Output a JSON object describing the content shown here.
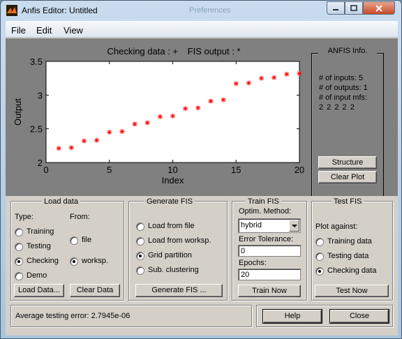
{
  "window": {
    "title": "Anfis Editor: Untitled",
    "ghost_title": "Preferences",
    "colors": {
      "plot_marker": "#ff0000"
    }
  },
  "menu": {
    "items": [
      "File",
      "Edit",
      "View"
    ]
  },
  "plot": {
    "title_left": "Checking data : +",
    "title_right": "FIS output : *"
  },
  "chart_data": {
    "type": "scatter",
    "xlabel": "Index",
    "ylabel": "Output",
    "xlim": [
      0,
      20
    ],
    "ylim": [
      2,
      3.5
    ],
    "xticks": [
      "0",
      "5",
      "10",
      "15",
      "20"
    ],
    "yticks": [
      "2",
      "2.5",
      "3",
      "3.5"
    ],
    "x": [
      1,
      2,
      3,
      4,
      5,
      6,
      7,
      8,
      9,
      10,
      11,
      12,
      13,
      14,
      15,
      16,
      17,
      18,
      19,
      20
    ],
    "y": [
      2.21,
      2.22,
      2.32,
      2.33,
      2.45,
      2.46,
      2.57,
      2.59,
      2.68,
      2.69,
      2.8,
      2.81,
      2.91,
      2.93,
      3.17,
      3.18,
      3.25,
      3.26,
      3.31,
      3.32
    ],
    "marker": "*",
    "color": "#ff0000"
  },
  "info": {
    "title": "ANFIS Info.",
    "lines": [
      "# of inputs: 5",
      "# of outputs: 1",
      "# of input mfs:",
      "2 2 2 2 2"
    ],
    "structure_label": "Structure",
    "clear_plot_label": "Clear Plot"
  },
  "load_data": {
    "title": "Load data",
    "type_label": "Type:",
    "from_label": "From:",
    "types": [
      {
        "label": "Training",
        "selected": false
      },
      {
        "label": "Testing",
        "selected": false
      },
      {
        "label": "Checking",
        "selected": true
      },
      {
        "label": "Demo",
        "selected": false
      }
    ],
    "sources": [
      {
        "label": "file",
        "selected": false
      },
      {
        "label": "worksp.",
        "selected": true
      }
    ],
    "load_button": "Load Data...",
    "clear_button": "Clear Data"
  },
  "generate_fis": {
    "title": "Generate FIS",
    "options": [
      {
        "label": "Load from file",
        "selected": false
      },
      {
        "label": "Load from worksp.",
        "selected": false
      },
      {
        "label": "Grid partition",
        "selected": true
      },
      {
        "label": "Sub. clustering",
        "selected": false
      }
    ],
    "button": "Generate FIS ..."
  },
  "train_fis": {
    "title": "Train FIS",
    "method_label": "Optim. Method:",
    "method_value": "hybrid",
    "tolerance_label": "Error Tolerance:",
    "tolerance_value": "0",
    "epochs_label": "Epochs:",
    "epochs_value": "20",
    "button": "Train Now"
  },
  "test_fis": {
    "title": "Test FIS",
    "plot_against_label": "Plot against:",
    "options": [
      {
        "label": "Training data",
        "selected": false
      },
      {
        "label": "Testing data",
        "selected": false
      },
      {
        "label": "Checking data",
        "selected": true
      }
    ],
    "button": "Test Now"
  },
  "status": {
    "text": "Average testing error: 2.7945e-06"
  },
  "footer": {
    "help_label": "Help",
    "close_label": "Close"
  }
}
